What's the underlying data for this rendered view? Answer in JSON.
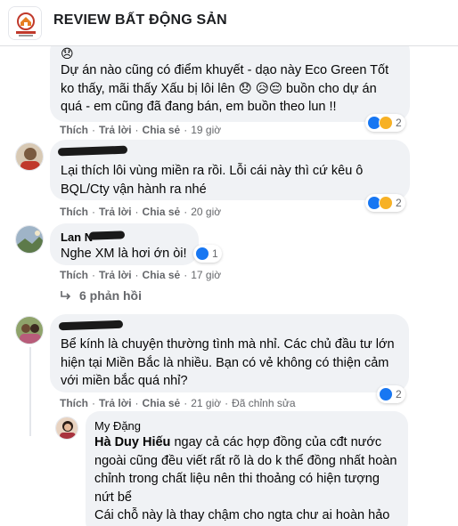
{
  "header": {
    "title": "REVIEW BẤT ĐỘNG SẢN",
    "logo_icon": "house-logo-icon"
  },
  "colors": {
    "accent": "#1877f2",
    "bubble": "#f0f2f5",
    "meta": "#65676b"
  },
  "comments": [
    {
      "text": "Dự án nào cũng có điểm khuyết - dạo này Eco Green Tốt ko thấy, mãi thấy Xấu bị lôi lên 😞 😥😔 buồn cho dự án quá - em cũng đã đang bán, em buồn theo lun !!",
      "actions": {
        "like": "Thích",
        "reply": "Trả lời",
        "share": "Chia sẻ",
        "time": "19 giờ"
      },
      "reaction_count": "2",
      "reaction_icons": [
        "like-icon",
        "wow-icon"
      ]
    },
    {
      "text": "Lại thích lôi vùng miền ra rồi. Lỗi cái này thì cứ kêu ô BQL/Cty vận hành ra nhé",
      "actions": {
        "like": "Thích",
        "reply": "Trả lời",
        "share": "Chia sẻ",
        "time": "20 giờ"
      },
      "reaction_count": "2",
      "reaction_icons": [
        "like-icon",
        "haha-icon"
      ]
    },
    {
      "author": "Lan N",
      "text": "Nghe XM là hơi ớn òi!",
      "actions": {
        "like": "Thích",
        "reply": "Trả lời",
        "share": "Chia sẻ",
        "time": "17 giờ"
      },
      "reaction_count": "1",
      "reaction_icons": [
        "like-icon"
      ],
      "replies_label": "6 phản hồi"
    },
    {
      "text": "Bể kính là chuyện thường tình mà nhỉ. Các chủ đầu tư lớn hiện tại Miền Bắc là nhiều. Bạn có vẻ không có thiện cảm với miền bắc quá nhỉ?",
      "actions": {
        "like": "Thích",
        "reply": "Trả lời",
        "share": "Chia sẻ",
        "time": "21 giờ",
        "edited": "Đã chỉnh sửa"
      },
      "reaction_count": "2",
      "reaction_icons": [
        "like-icon"
      ]
    },
    {
      "author": "My Đặng",
      "mention": "Hà Duy Hiếu",
      "text": " ngay cả các hợp đồng của cđt nước ngoài cũng đều viết rất rõ là do k thể đồng nhất hoàn chỉnh trong chất liệu nên thi thoảng có hiện tượng nứt bể",
      "text2": "Cái chỗ này là thay chậm cho ngta chư ai hoàn hảo mà k bể"
    }
  ]
}
